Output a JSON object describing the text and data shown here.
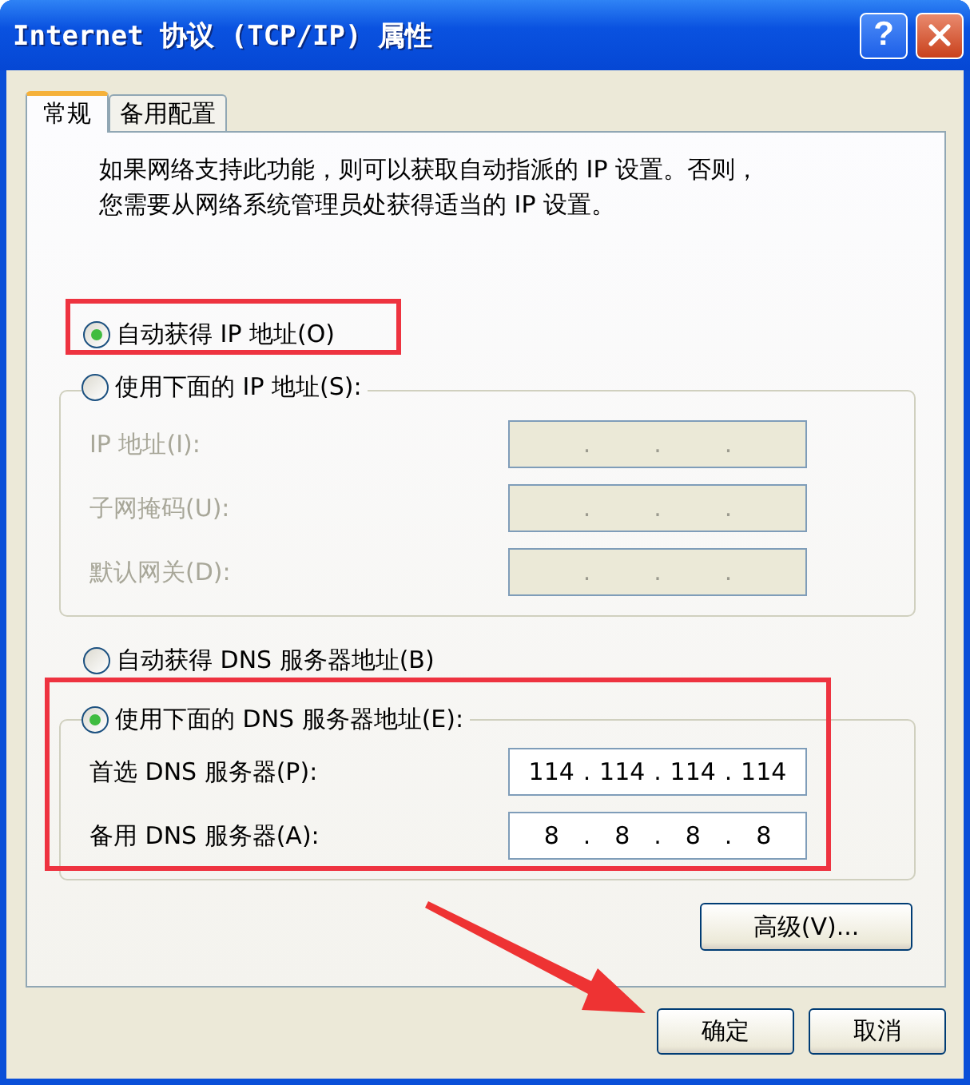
{
  "window": {
    "title": "Internet 协议 (TCP/IP) 属性",
    "help_button": "?"
  },
  "tabs": [
    {
      "label": "常规",
      "selected": true
    },
    {
      "label": "备用配置",
      "selected": false
    }
  ],
  "intro": [
    "如果网络支持此功能，则可以获取自动指派的 IP 设置。否则，",
    "您需要从网络系统管理员处获得适当的 IP 设置。"
  ],
  "sections": [
    {
      "radio": {
        "label": "自动获得 IP 地址(O)",
        "selected": true
      }
    },
    {
      "radio": {
        "label": "使用下面的 IP 地址(S):",
        "selected": false
      },
      "fields": [
        {
          "label": "IP 地址(I):",
          "disabled": true,
          "dots": [
            ".",
            ".",
            "."
          ]
        },
        {
          "label": "子网掩码(U):",
          "disabled": true,
          "dots": [
            ".",
            ".",
            "."
          ]
        },
        {
          "label": "默认网关(D):",
          "disabled": true,
          "dots": [
            ".",
            ".",
            "."
          ]
        }
      ]
    },
    {
      "radio": {
        "label": "自动获得 DNS 服务器地址(B)",
        "selected": false
      }
    },
    {
      "radio": {
        "label": "使用下面的 DNS 服务器地址(E):",
        "selected": true
      },
      "fields": [
        {
          "label": "首选 DNS 服务器(P):",
          "disabled": false,
          "octets": [
            "114",
            "114",
            "114",
            "114"
          ],
          "dots": [
            ".",
            ".",
            "."
          ]
        },
        {
          "label": "备用 DNS 服务器(A):",
          "disabled": false,
          "octets": [
            "8",
            "8",
            "8",
            "8"
          ],
          "dots": [
            ".",
            ".",
            "."
          ]
        }
      ]
    }
  ],
  "advanced_button": "高级(V)...",
  "buttons": [
    "确定",
    "取消"
  ]
}
